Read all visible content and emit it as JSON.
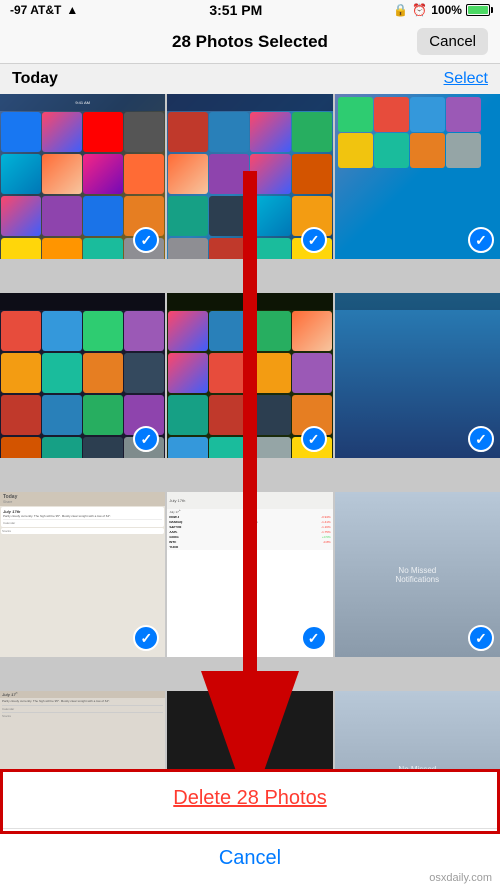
{
  "statusBar": {
    "carrier": "-97 AT&T",
    "wifi": "WiFi",
    "time": "3:51 PM",
    "lock": "🔒",
    "alarm": "⏰",
    "battery": "100%"
  },
  "navBar": {
    "title": "28 Photos Selected",
    "cancelLabel": "Cancel"
  },
  "sectionHeader": {
    "title": "Today",
    "selectLabel": "Select"
  },
  "photos": [
    {
      "id": 1,
      "checked": true,
      "type": "ios-home"
    },
    {
      "id": 2,
      "checked": true,
      "type": "ios-home2"
    },
    {
      "id": 3,
      "checked": true,
      "type": "ios-home3"
    },
    {
      "id": 4,
      "checked": true,
      "type": "ios-dark"
    },
    {
      "id": 5,
      "checked": true,
      "type": "ios-dark2"
    },
    {
      "id": 6,
      "checked": true,
      "type": "ios-blue"
    },
    {
      "id": 7,
      "checked": true,
      "type": "ios-today"
    },
    {
      "id": 8,
      "checked": true,
      "type": "ios-notif"
    },
    {
      "id": 9,
      "checked": true,
      "type": "ios-notif2"
    },
    {
      "id": 10,
      "checked": true,
      "type": "ios-today2"
    },
    {
      "id": 11,
      "checked": true,
      "type": "ios-stocks"
    },
    {
      "id": 12,
      "checked": true,
      "type": "ios-music"
    }
  ],
  "bottomSheet": {
    "deleteLabel": "Delete 28 Photos",
    "cancelLabel": "Cancel"
  },
  "watermark": "osxdaily.com",
  "stocksData": [
    {
      "symbol": "DOW J",
      "value": "16,576.81",
      "change": "-0.94%",
      "negative": true
    },
    {
      "symbol": "NASDAQ",
      "value": "4,363.45",
      "change": "-1.41%",
      "negative": true
    },
    {
      "symbol": "S&P 500",
      "value": "1,998.12",
      "change": "-1.16%",
      "negative": true
    },
    {
      "symbol": "AAPL",
      "value": "93.08",
      "change": "-1.75%",
      "negative": true
    },
    {
      "symbol": "GOOG",
      "value": "573.73",
      "change": "",
      "negative": false
    },
    {
      "symbol": "INTC",
      "value": "33.",
      "change": "",
      "negative": false
    },
    {
      "symbol": "YHOO",
      "value": "",
      "change": "",
      "negative": false
    }
  ]
}
